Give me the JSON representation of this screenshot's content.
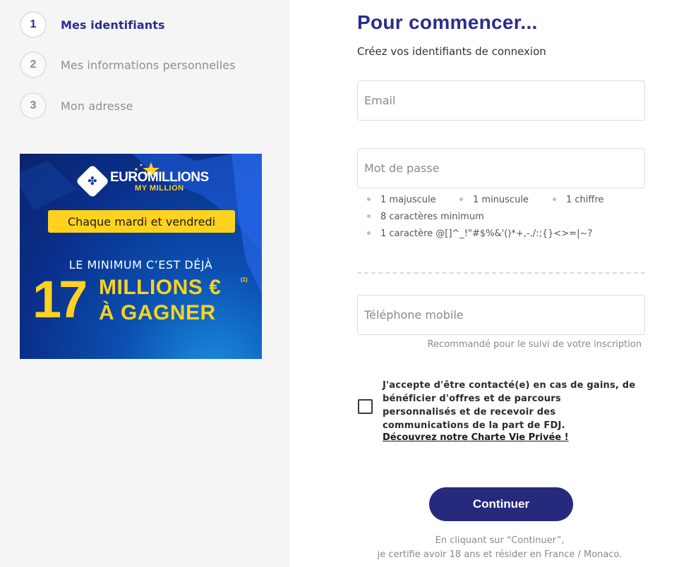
{
  "steps": [
    {
      "number": "1",
      "label": "Mes identifiants",
      "active": true
    },
    {
      "number": "2",
      "label": "Mes informations personnelles",
      "active": false
    },
    {
      "number": "3",
      "label": "Mon adresse",
      "active": false
    }
  ],
  "ad": {
    "brand": "EUROMILLIONS",
    "brand_sub": "MY MILLION",
    "schedule": "Chaque mardi et vendredi",
    "minimum": "LE MINIMUM C’EST DÉJÀ",
    "amount": "17",
    "prize_line1": "MILLIONS €",
    "prize_line2": "À GAGNER",
    "note": "(1)"
  },
  "form": {
    "title": "Pour commencer...",
    "subtitle": "Créez vos identifiants de connexion",
    "email_placeholder": "Email",
    "password_placeholder": "Mot de passe",
    "password_rules": [
      "1 majuscule",
      "1 minuscule",
      "1 chiffre",
      "8 caractères minimum",
      "1 caractère @[]^_!\"#$%&'()*+,-./:;{}<>=|~?"
    ],
    "phone_placeholder": "Téléphone mobile",
    "phone_hint": "Recommandé pour le suivi de votre inscription",
    "consent_text": "J'accepte d'être contacté(e) en cas de gains, de bénéficier d'offres et de parcours personnalisés et de recevoir des communications de la part de FDJ.",
    "privacy_link": "Découvrez notre Charte Vie Privée !",
    "continue_label": "Continuer",
    "legal_line1": "En cliquant sur “Continuer”,",
    "legal_line2": "je certifie avoir 18 ans et résider en France / Monaco."
  },
  "colors": {
    "brand_primary": "#2a2d8e",
    "button": "#272a7c",
    "ad_yellow": "#ffd21f",
    "ad_blue": "#0a3fa8"
  }
}
